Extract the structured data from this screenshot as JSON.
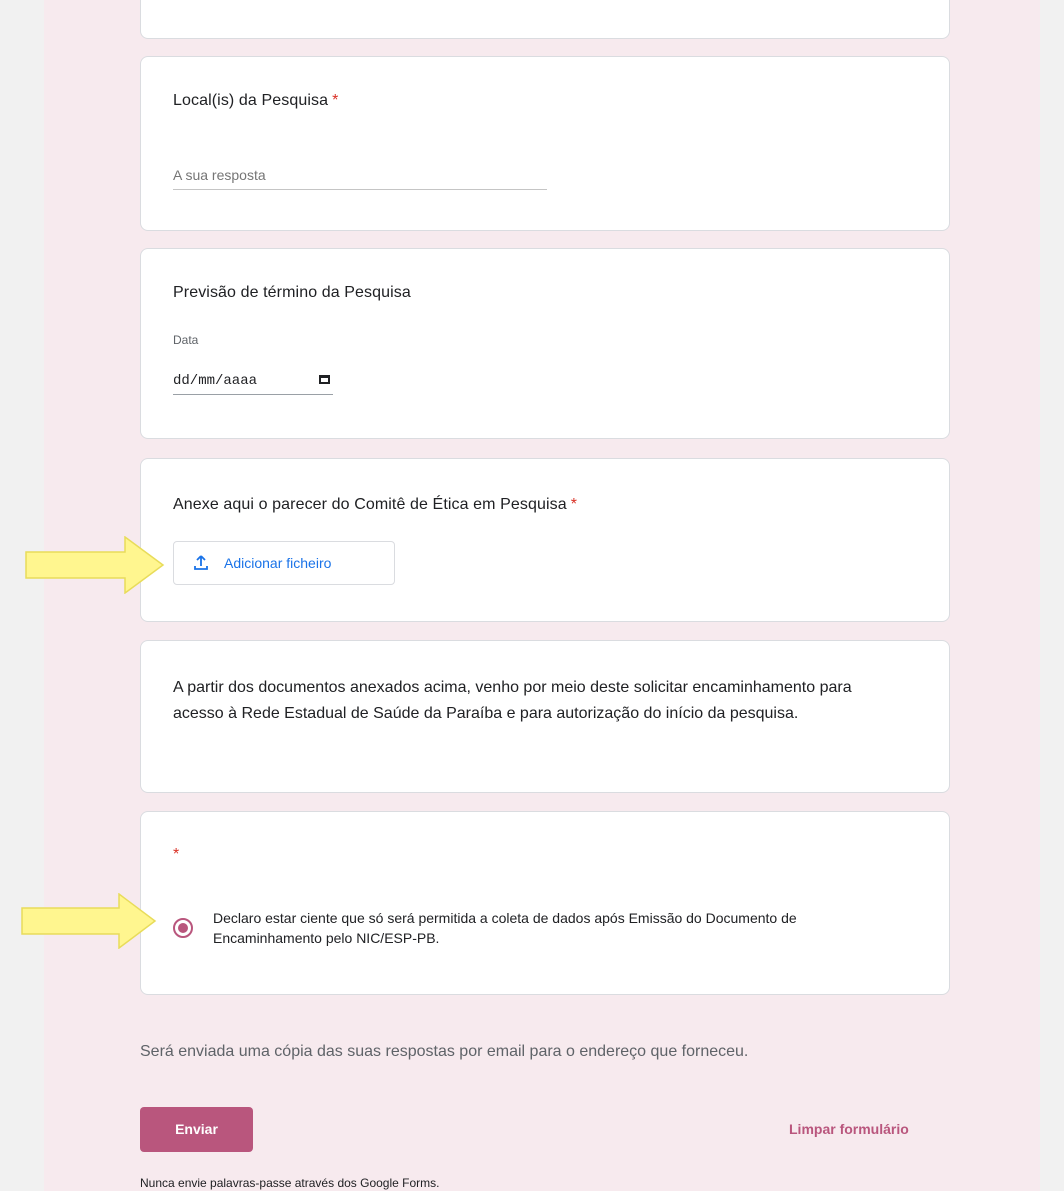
{
  "form": {
    "question_local": {
      "title": "Local(is) da Pesquisa",
      "required_mark": "*",
      "placeholder": "A sua resposta"
    },
    "question_date": {
      "title": "Previsão de término da Pesquisa",
      "label": "Data",
      "placeholder": "dd/mm/aaaa",
      "icon": "calendar-icon"
    },
    "question_upload": {
      "title": "Anexe aqui o parecer do Comitê de Ética em Pesquisa",
      "required_mark": "*",
      "button_label": "Adicionar ficheiro",
      "icon": "upload-icon"
    },
    "description": "A partir dos documentos anexados acima, venho por meio deste solicitar encaminhamento para acesso à Rede Estadual de Saúde da Paraíba e para autorização do início da pesquisa.",
    "question_declaration": {
      "required_mark": "*",
      "option_label": "Declaro estar ciente que só será permitida a coleta de dados após Emissão do Documento de Encaminhamento pelo NIC/ESP-PB.",
      "selected": true
    }
  },
  "footer": {
    "copy_note": "Será enviada uma cópia das suas respostas por email para o endereço que forneceu.",
    "submit_label": "Enviar",
    "clear_label": "Limpar formulário",
    "password_note": "Nunca envie palavras-passe através dos Google Forms."
  },
  "colors": {
    "accent": "#b9567d",
    "required": "#d93025",
    "link_blue": "#1a73e8",
    "annotation_arrow": "#fff68f"
  }
}
